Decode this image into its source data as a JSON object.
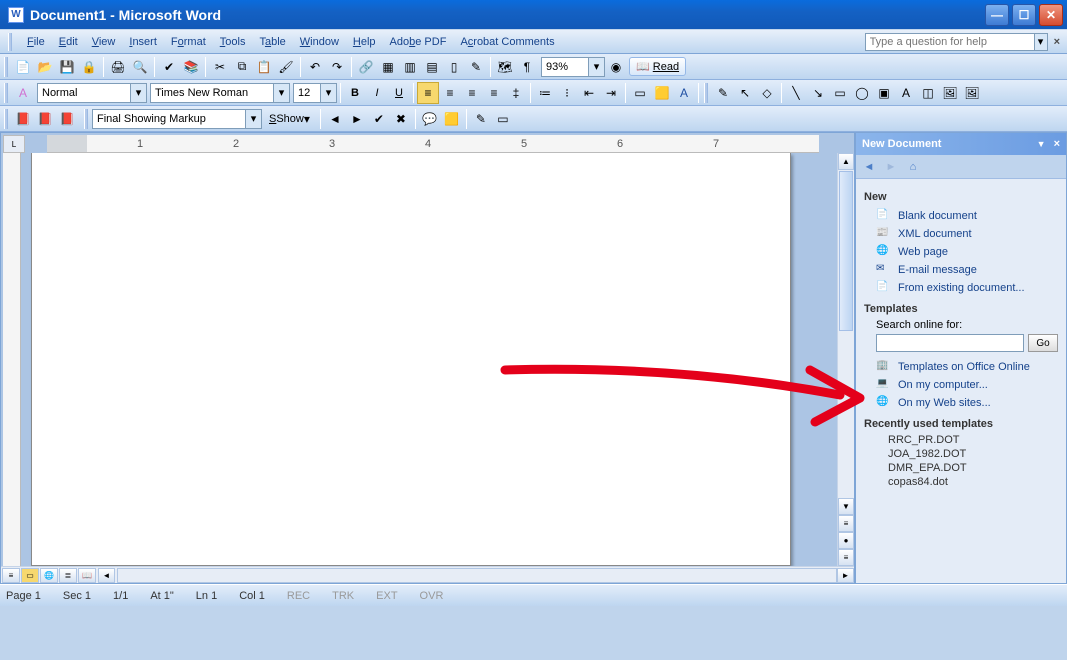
{
  "window": {
    "title": "Document1 - Microsoft Word"
  },
  "menus": [
    "File",
    "Edit",
    "View",
    "Insert",
    "Format",
    "Tools",
    "Table",
    "Window",
    "Help",
    "Adobe PDF",
    "Acrobat Comments"
  ],
  "help_placeholder": "Type a question for help",
  "formatting": {
    "style": "Normal",
    "font": "Times New Roman",
    "size": "12",
    "zoom": "93%",
    "read": "Read"
  },
  "reviewing": {
    "display": "Final Showing Markup",
    "show": "Show"
  },
  "ruler_marks": [
    "1",
    "2",
    "3",
    "4",
    "5",
    "6",
    "7"
  ],
  "status": {
    "page": "Page 1",
    "sec": "Sec 1",
    "pages": "1/1",
    "at": "At 1\"",
    "ln": "Ln 1",
    "col": "Col 1",
    "rec": "REC",
    "trk": "TRK",
    "ext": "EXT",
    "ovr": "OVR"
  },
  "taskpane": {
    "title": "New Document",
    "sections": {
      "new_title": "New",
      "new_items": [
        "Blank document",
        "XML document",
        "Web page",
        "E-mail message",
        "From existing document..."
      ],
      "templates_title": "Templates",
      "search_label": "Search online for:",
      "go": "Go",
      "template_items": [
        "Templates on Office Online",
        "On my computer...",
        "On my Web sites..."
      ],
      "recent_title": "Recently used templates",
      "recent_items": [
        "RRC_PR.DOT",
        "JOA_1982.DOT",
        "DMR_EPA.DOT",
        "copas84.dot"
      ]
    }
  }
}
